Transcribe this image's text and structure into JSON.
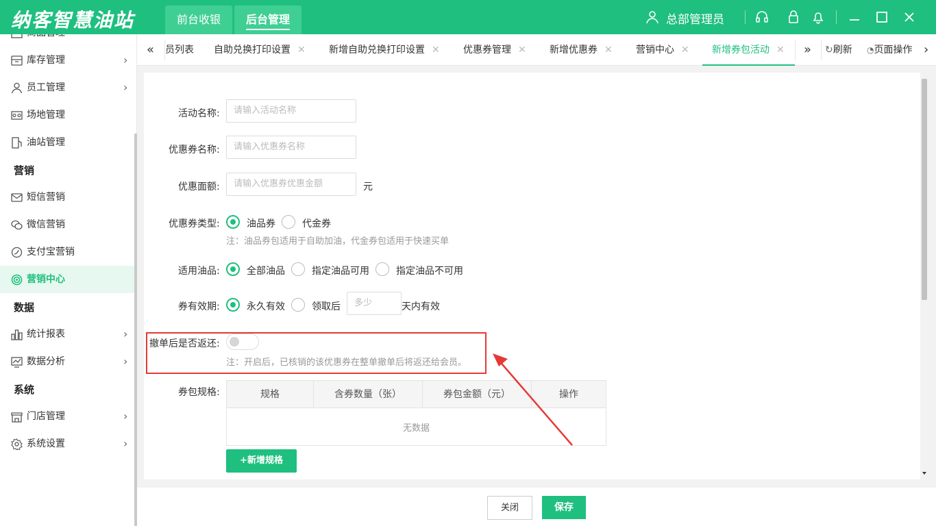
{
  "app": {
    "logo": "纳客智慧油站"
  },
  "top_tabs": [
    {
      "label": "前台收银"
    },
    {
      "label": "后台管理"
    }
  ],
  "user": {
    "name": "总部管理员"
  },
  "sidebar": {
    "partial_top": "商品管理",
    "items": [
      {
        "label": "库存管理",
        "icon": "inventory-icon",
        "arrow": "›"
      },
      {
        "label": "员工管理",
        "icon": "person-icon",
        "arrow": "›"
      },
      {
        "label": "场地管理",
        "icon": "venue-icon"
      },
      {
        "label": "油站管理",
        "icon": "station-icon"
      }
    ],
    "sections": {
      "marketing": "营销",
      "data": "数据",
      "system": "系统"
    },
    "marketing_items": [
      {
        "label": "短信营销",
        "icon": "mail-icon"
      },
      {
        "label": "微信营销",
        "icon": "wechat-icon"
      },
      {
        "label": "支付宝营销",
        "icon": "alipay-icon"
      },
      {
        "label": "营销中心",
        "icon": "target-icon"
      }
    ],
    "data_items": [
      {
        "label": "统计报表",
        "icon": "chart-icon",
        "arrow": "›"
      },
      {
        "label": "数据分析",
        "icon": "analysis-icon",
        "arrow": "›"
      }
    ],
    "system_items": [
      {
        "label": "门店管理",
        "icon": "store-icon",
        "arrow": "›"
      },
      {
        "label": "系统设置",
        "icon": "settings-icon",
        "arrow": "›"
      }
    ]
  },
  "page_tabs": {
    "prev": "«",
    "items": [
      "员列表",
      "自助兑换打印设置",
      "新增自助兑换打印设置",
      "优惠券管理",
      "新增优惠券",
      "营销中心",
      "新增券包活动"
    ],
    "next": "»",
    "refresh": "刷新",
    "page_ops": "页面操作",
    "more": "›"
  },
  "form": {
    "activity_name": {
      "label": "活动名称:",
      "placeholder": "请输入活动名称"
    },
    "coupon_name": {
      "label": "优惠券名称:",
      "placeholder": "请输入优惠券名称"
    },
    "coupon_amount": {
      "label": "优惠面额:",
      "placeholder": "请输入优惠券优惠金额",
      "unit": "元"
    },
    "coupon_type": {
      "label": "优惠券类型:",
      "options": [
        "油品券",
        "代金券"
      ],
      "selected": "油品券",
      "note": "注：油品券包适用于自助加油，代金券包适用于快速买单"
    },
    "applicable_oil": {
      "label": "适用油品:",
      "options": [
        "全部油品",
        "指定油品可用",
        "指定油品不可用"
      ],
      "selected": "全部油品"
    },
    "validity": {
      "label": "券有效期:",
      "options": [
        "永久有效",
        "领取后"
      ],
      "selected": "永久有效",
      "days_placeholder": "多少",
      "days_suffix": "天内有效"
    },
    "refund_on_cancel": {
      "label": "撤单后是否返还:",
      "value": false,
      "note": "注：开启后，已核销的该优惠券在整单撤单后将返还给会员。"
    },
    "package_spec": {
      "label": "券包规格:",
      "columns": [
        "规格",
        "含券数量（张）",
        "券包金额（元）",
        "操作"
      ],
      "empty": "无数据",
      "add_button": "+新增规格"
    }
  },
  "footer": {
    "close": "关闭",
    "save": "保存"
  },
  "colors": {
    "brand": "#1fbf7f",
    "highlight": "#e53935"
  }
}
